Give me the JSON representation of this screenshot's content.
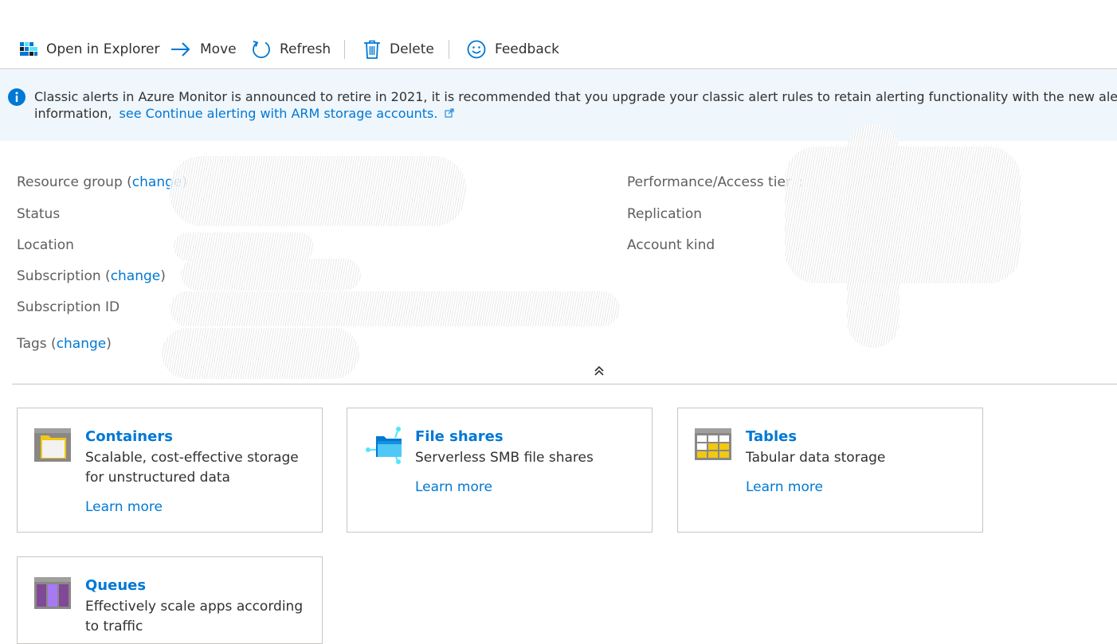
{
  "toolbar": {
    "open_in_explorer": "Open in Explorer",
    "move": "Move",
    "refresh": "Refresh",
    "delete": "Delete",
    "feedback": "Feedback"
  },
  "banner": {
    "text": "Classic alerts in Azure Monitor is announced to retire in 2021, it is recommended that you upgrade your classic alert rules to retain alerting functionality with the new alerting platform. For more",
    "text2": "information,",
    "link": "see Continue alerting with ARM storage accounts."
  },
  "essentials": {
    "resource_group": "Resource group",
    "status": "Status",
    "location": "Location",
    "subscription": "Subscription",
    "subscription_id": "Subscription ID",
    "tags": "Tags",
    "change": "change",
    "paren_open": "(",
    "paren_close": ")",
    "performance_tier": "Performance/Access tier",
    "colon": ":",
    "replication": "Replication",
    "account_kind": "Account kind"
  },
  "cards": [
    {
      "title": "Containers",
      "desc": "Scalable, cost-effective storage for unstructured data",
      "learn": "Learn more",
      "icon": "containers-icon"
    },
    {
      "title": "File shares",
      "desc": "Serverless SMB file shares",
      "learn": "Learn more",
      "icon": "file-shares-icon"
    },
    {
      "title": "Tables",
      "desc": "Tabular data storage",
      "learn": "Learn more",
      "icon": "tables-icon"
    },
    {
      "title": "Queues",
      "desc": "Effectively scale apps according to traffic",
      "learn": "Learn more",
      "icon": "queues-icon"
    }
  ],
  "colors": {
    "accent": "#0078d4",
    "banner_bg": "#eff6fc",
    "border": "#c8c6c4"
  }
}
